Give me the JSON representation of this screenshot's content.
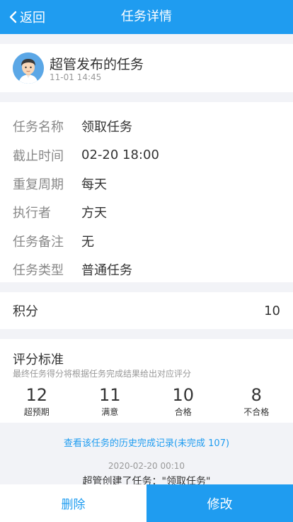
{
  "navbar": {
    "back_label": "返回",
    "title": "任务详情"
  },
  "publisher": {
    "title": "超管发布的任务",
    "time": "11-01 14:45"
  },
  "details": [
    {
      "label": "任务名称",
      "value": "领取任务"
    },
    {
      "label": "截止时间",
      "value": "02-20 18:00"
    },
    {
      "label": "重复周期",
      "value": "每天"
    },
    {
      "label": "执行者",
      "value": "方天"
    },
    {
      "label": "任务备注",
      "value": "无"
    },
    {
      "label": "任务类型",
      "value": "普通任务"
    }
  ],
  "score": {
    "label": "积分",
    "value": "10"
  },
  "criteria": {
    "title": "评分标准",
    "subtitle": "最终任务得分将根据任务完成结果给出对应评分",
    "levels": [
      {
        "value": "12",
        "name": "超预期"
      },
      {
        "value": "11",
        "name": "满意"
      },
      {
        "value": "10",
        "name": "合格"
      },
      {
        "value": "8",
        "name": "不合格"
      }
    ]
  },
  "history": {
    "link": "查看该任务的历史完成记录(未完成 107)",
    "log_time": "2020-02-20 00:10",
    "log_text": "超管创建了任务：\"领取任务\""
  },
  "actions": {
    "delete": "删除",
    "edit": "修改"
  }
}
